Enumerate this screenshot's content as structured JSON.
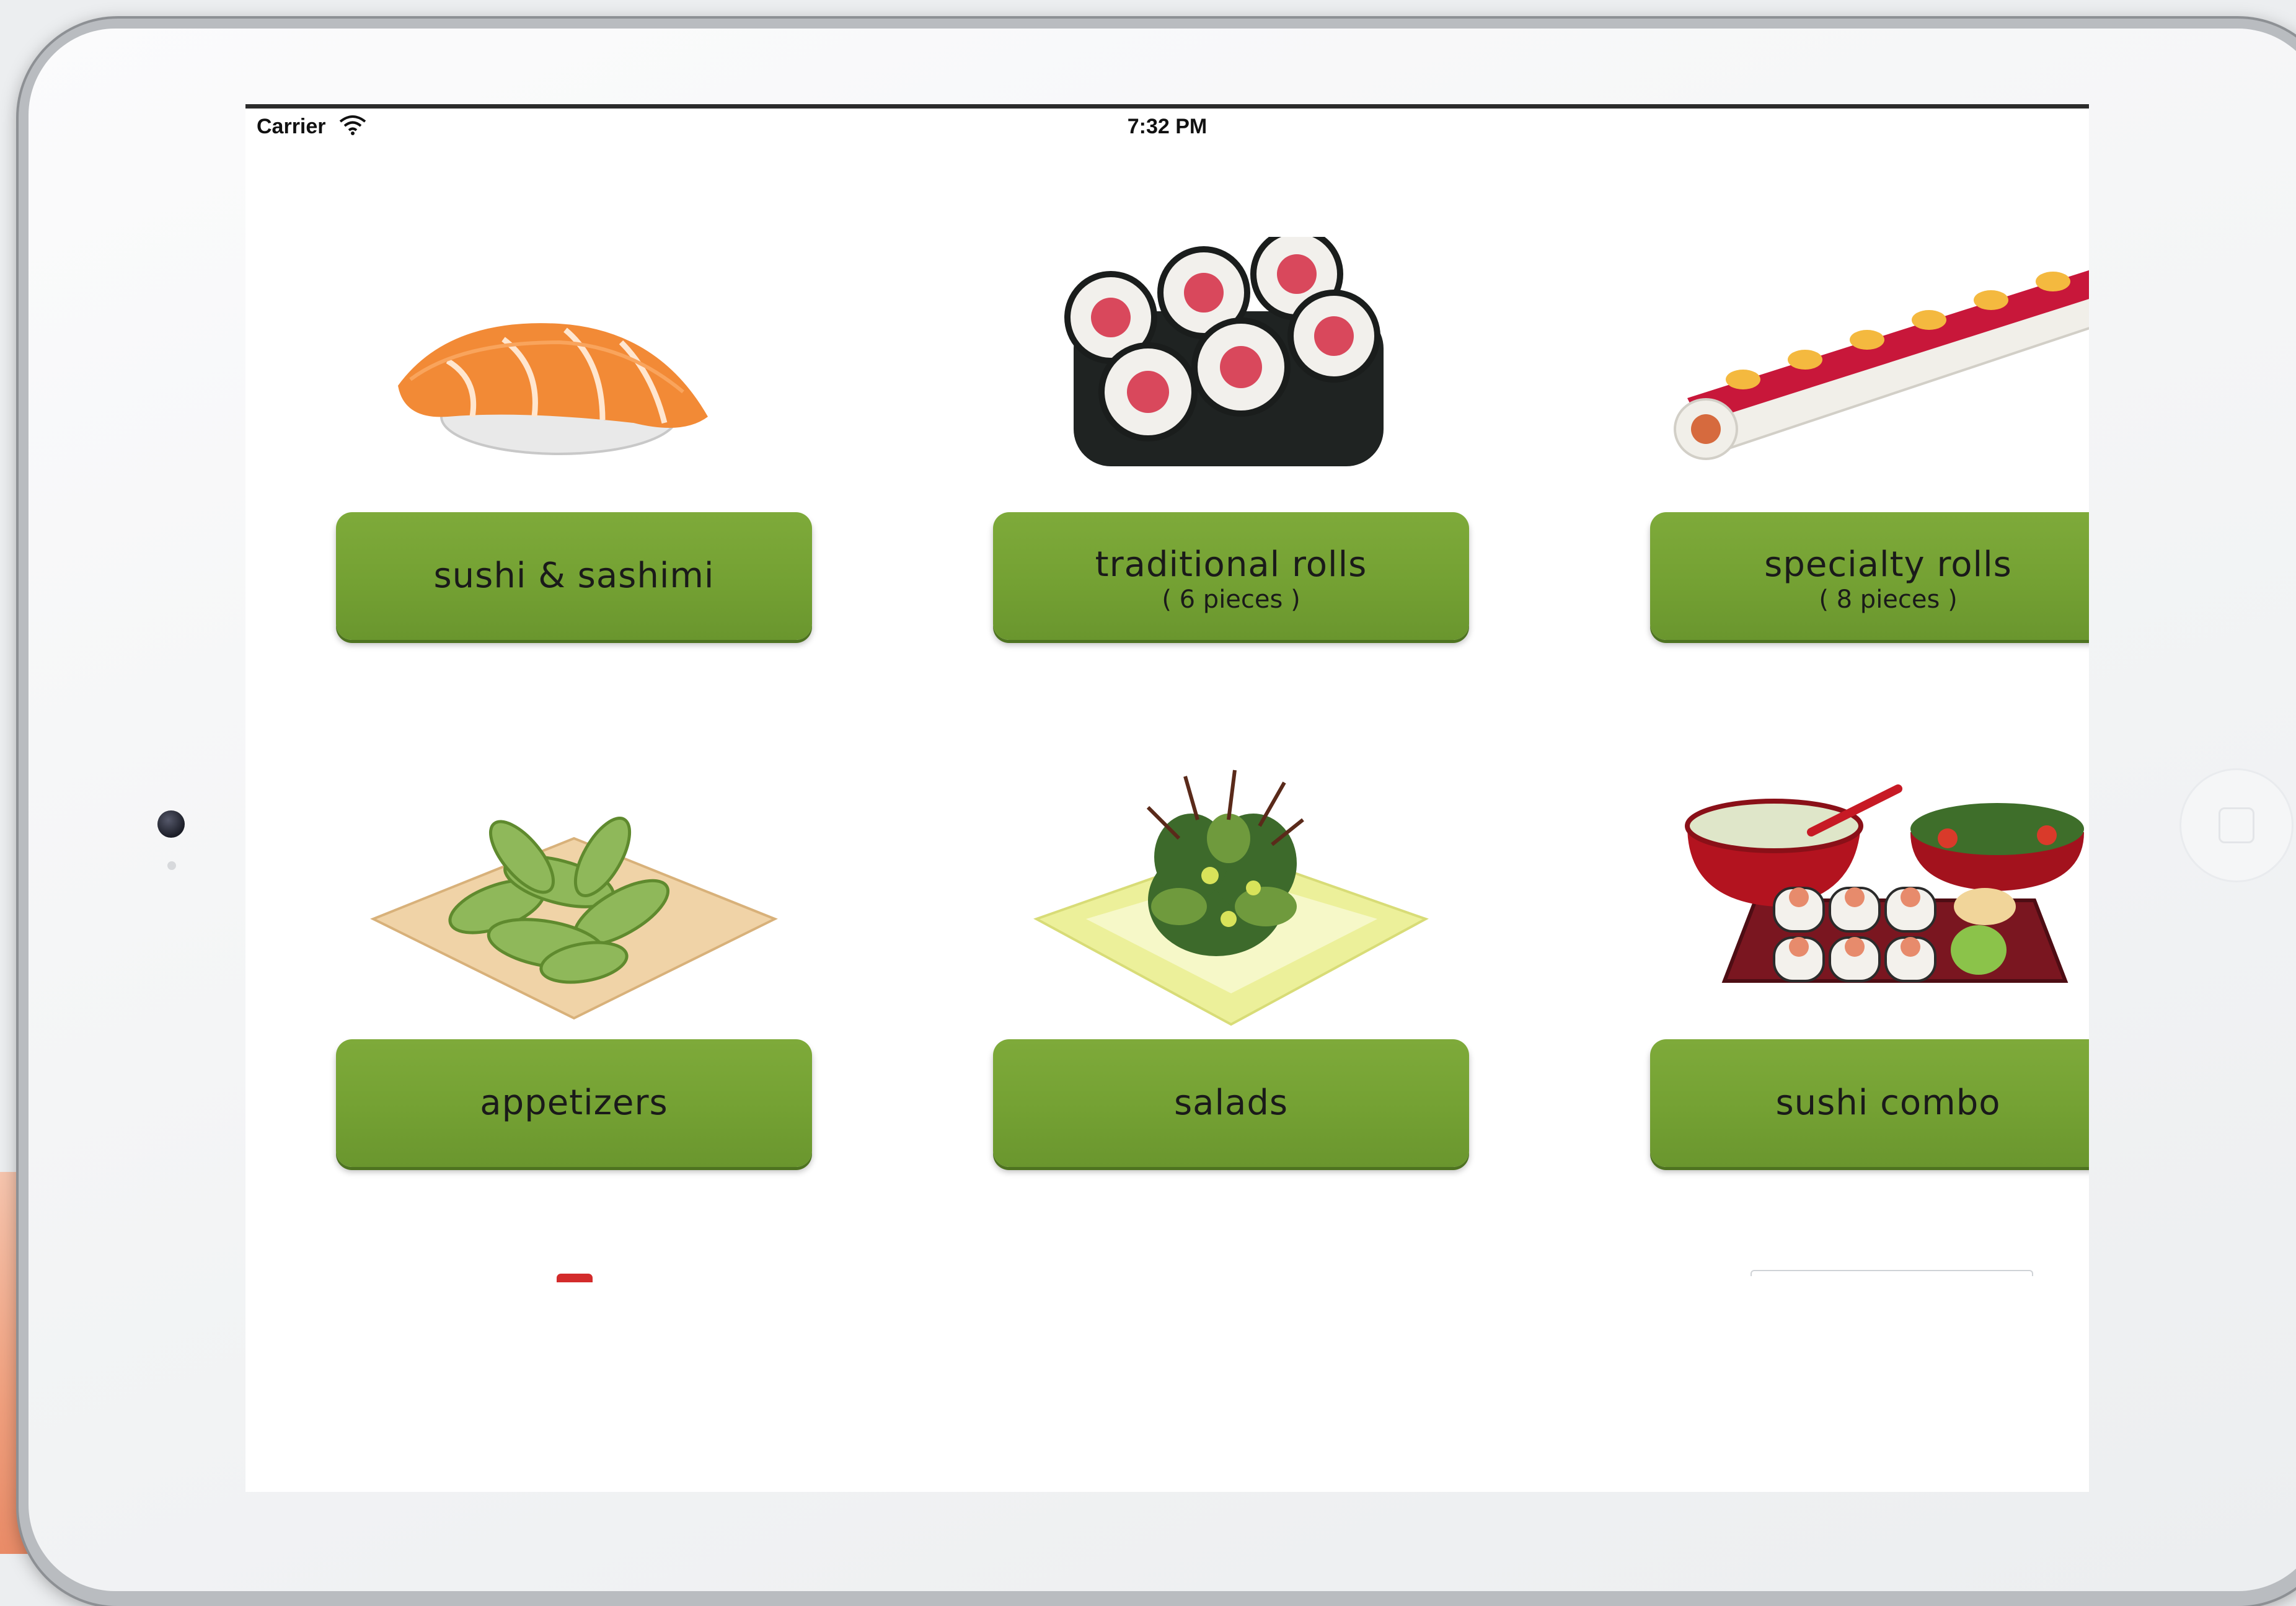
{
  "status_bar": {
    "carrier": "Carrier",
    "time": "7:32 PM"
  },
  "menu": {
    "categories": [
      {
        "label": "sushi & sashimi",
        "sublabel": "",
        "image_icon": "nigiri-sushi-icon"
      },
      {
        "label": "traditional rolls",
        "sublabel": "( 6 pieces )",
        "image_icon": "maki-rolls-icon"
      },
      {
        "label": "specialty rolls",
        "sublabel": "( 8 pieces )",
        "image_icon": "specialty-roll-icon"
      },
      {
        "label": "appetizers",
        "sublabel": "",
        "image_icon": "edamame-icon"
      },
      {
        "label": "salads",
        "sublabel": "",
        "image_icon": "salad-icon"
      },
      {
        "label": "sushi combo",
        "sublabel": "",
        "image_icon": "sushi-combo-icon"
      }
    ]
  },
  "colors": {
    "button_green": "#74a133",
    "screen_bg": "#ffffff",
    "bezel": "#f4f5f6"
  }
}
